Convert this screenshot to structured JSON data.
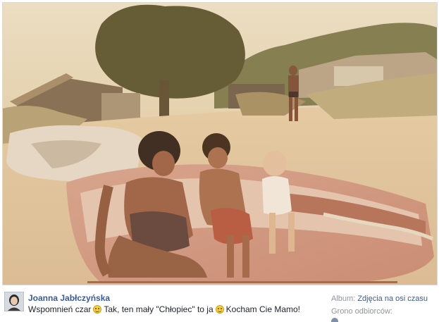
{
  "photo": {
    "description_icon": "vintage-beach-photo"
  },
  "post": {
    "author_name": "Joanna Jabłczyńska",
    "message_part1": "Wspomnień czar",
    "message_part2": "Tak, ten mały \"Chłopiec\" to ja",
    "message_part3": "Kocham Cie Mamo!",
    "emoticon": "smiley-icon"
  },
  "sidebar": {
    "album_prefix": "Album:",
    "album_name": "Zdjęcia na osi czasu",
    "audience_label": "Grono odbiorców:"
  },
  "colors": {
    "link": "#3b5998",
    "muted": "#90949c",
    "text": "#1d2129"
  }
}
